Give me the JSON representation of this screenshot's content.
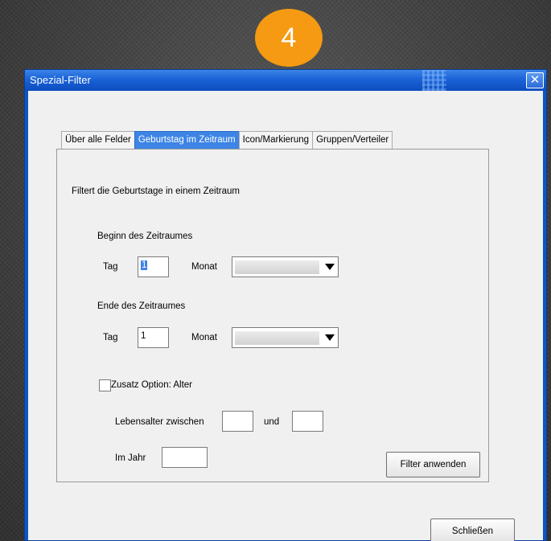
{
  "badge": {
    "number": "4"
  },
  "window": {
    "title": "Spezial-Filter",
    "close_glyph": "✕"
  },
  "tabs": [
    {
      "label": "Über alle Felder",
      "active": false
    },
    {
      "label": "Geburtstag im Zeitraum",
      "active": true
    },
    {
      "label": "Icon/Markierung",
      "active": false
    },
    {
      "label": "Gruppen/Verteiler",
      "active": false
    }
  ],
  "panel": {
    "description": "Filtert die Geburtstage in einem Zeitraum",
    "begin": {
      "heading": "Beginn des Zeitraumes",
      "tag_label": "Tag",
      "tag_value": "1",
      "monat_label": "Monat",
      "monat_value": ""
    },
    "end": {
      "heading": "Ende des Zeitraumes",
      "tag_label": "Tag",
      "tag_value": "1",
      "monat_label": "Monat",
      "monat_value": ""
    },
    "option": {
      "checkbox_label": "Zusatz Option: Alter",
      "checked": false,
      "age_between_label": "Lebensalter zwischen",
      "age_from_value": "",
      "und_label": "und",
      "age_to_value": "",
      "year_label": "Im Jahr",
      "year_value": ""
    },
    "apply_button": "Filter anwenden"
  },
  "close_button": "Schließen",
  "icons": {
    "dropdown": "dropdown-arrow-icon",
    "close": "close-icon"
  }
}
